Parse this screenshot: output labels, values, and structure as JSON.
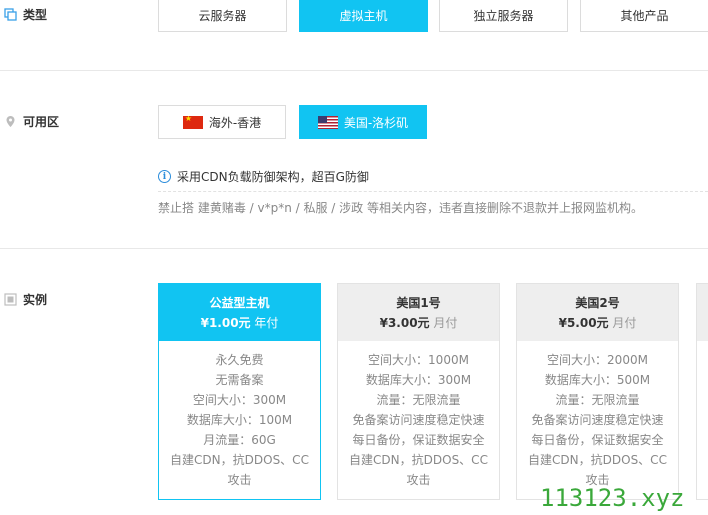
{
  "type_section": {
    "label": "类型",
    "options": [
      "云服务器",
      "虚拟主机",
      "独立服务器",
      "其他产品"
    ]
  },
  "zone_section": {
    "label": "可用区",
    "options": [
      "海外-香港",
      "美国-洛杉矶"
    ],
    "notice": "采用CDN负载防御架构，超百G防御",
    "warning": "禁止搭 建黄赌毒 / v*p*n / 私服 / 涉政 等相关内容，违者直接删除不退款并上报网监机构。"
  },
  "instance_section": {
    "label": "实例",
    "cards": [
      {
        "name": "公益型主机",
        "price": "¥1.00元",
        "unit": "年付",
        "features": [
          "永久免费",
          "无需备案",
          "空间大小：300M",
          "数据库大小：100M",
          "月流量：60G",
          "自建CDN，抗DDOS、CC",
          "攻击"
        ]
      },
      {
        "name": "美国1号",
        "price": "¥3.00元",
        "unit": "月付",
        "features": [
          "空间大小：1000M",
          "数据库大小：300M",
          "流量：无限流量",
          "免备案访问速度稳定快速",
          "每日备份，保证数据安全",
          "自建CDN，抗DDOS、CC",
          "攻击"
        ]
      },
      {
        "name": "美国2号",
        "price": "¥5.00元",
        "unit": "月付",
        "features": [
          "空间大小：2000M",
          "数据库大小：500M",
          "流量：无限流量",
          "免备案访问速度稳定快速",
          "每日备份，保证数据安全",
          "自建CDN，抗DDOS、CC",
          "攻击"
        ]
      }
    ]
  },
  "watermark": "113123.xyz",
  "colors": {
    "accent": "#11c4f2",
    "watermark": "#3aa83a"
  }
}
